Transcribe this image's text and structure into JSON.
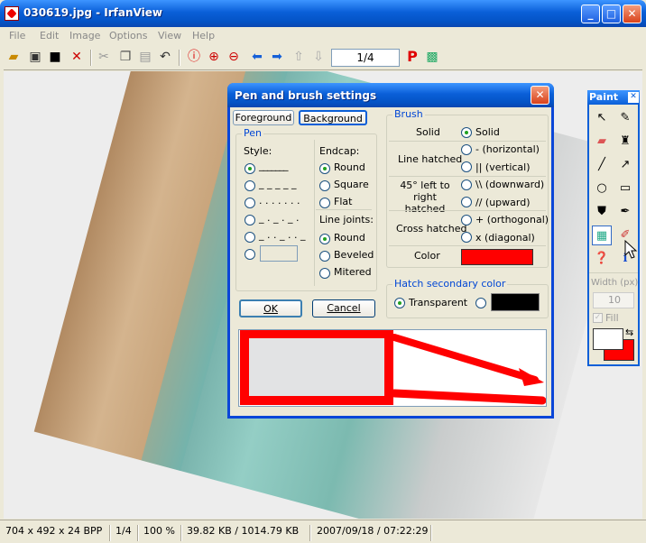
{
  "window": {
    "title": "030619.jpg - IrfanView"
  },
  "menu": [
    "File",
    "Edit",
    "Image",
    "Options",
    "View",
    "Help"
  ],
  "toolbar": {
    "page_indicator": "1/4",
    "paint_letter": "P"
  },
  "status": {
    "dimensions": "704 x 492 x 24 BPP",
    "page": "1/4",
    "zoom": "100 %",
    "filesize": "39.82 KB / 1014.79 KB",
    "datetime": "2007/09/18 / 07:22:29"
  },
  "dialog": {
    "title": "Pen and brush settings",
    "tabs": [
      "Foreground",
      "Background"
    ],
    "pen": {
      "group": "Pen",
      "style_label": "Style:",
      "endcap_label": "Endcap:",
      "endcaps": [
        "Round",
        "Square",
        "Flat"
      ],
      "joints_label": "Line joints:",
      "joints": [
        "Round",
        "Beveled",
        "Mitered"
      ]
    },
    "brush": {
      "group": "Brush",
      "rows": [
        {
          "label": "Solid",
          "option": "Solid"
        },
        {
          "label": "Line hatched",
          "option": "- (horizontal)",
          "option2": "|| (vertical)"
        },
        {
          "label": "45° left to right hatched",
          "option": "\\\\ (downward)",
          "option2": "// (upward)"
        },
        {
          "label": "Cross hatched",
          "option": "+ (orthogonal)",
          "option2": "x (diagonal)"
        }
      ],
      "color_label": "Color",
      "color": "#ff0000"
    },
    "hatch": {
      "group": "Hatch secondary color",
      "transparent": "Transparent",
      "color": "#000000"
    },
    "ok": "OK",
    "cancel": "Cancel"
  },
  "paint": {
    "title": "Paint",
    "width_label": "Width (px)",
    "width_value": "10",
    "fill_label": "Fill",
    "fg_color": "#ffffff",
    "bg_color": "#ff0000"
  }
}
